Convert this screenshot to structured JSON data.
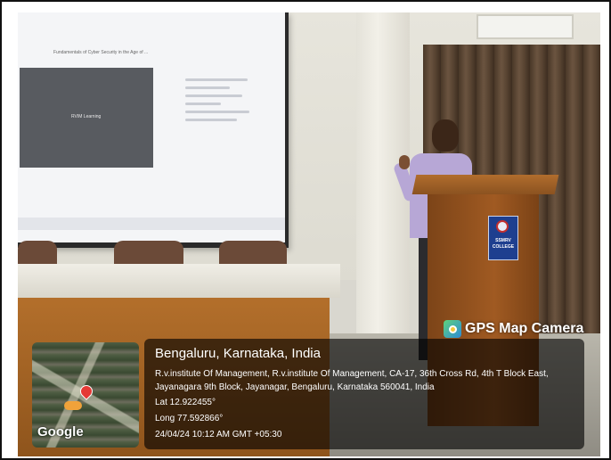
{
  "screen": {
    "title": "Fundamentals of Cyber Security in the Age of ...",
    "video_label": "RVIM Learning"
  },
  "podium": {
    "badge_text": "SSMRV\nCOLLEGE"
  },
  "gps": {
    "brand": "GPS Map Camera",
    "map_attribution": "Google",
    "place": "Bengaluru, Karnataka, India",
    "address": "R.v.institute Of Management, R.v.institute Of Management, CA-17, 36th Cross Rd, 4th T Block East, Jayanagara 9th Block, Jayanagar, Bengaluru, Karnataka 560041, India",
    "lat": "Lat 12.922455°",
    "long": "Long 77.592866°",
    "datetime": "24/04/24 10:12 AM GMT +05:30"
  },
  "colors": {
    "overlay_bg": "#000000",
    "podium_wood": "#a05a22",
    "badge_blue": "#1e3f8f"
  },
  "icons": [
    "gps-camera-icon",
    "map-pin-icon"
  ]
}
